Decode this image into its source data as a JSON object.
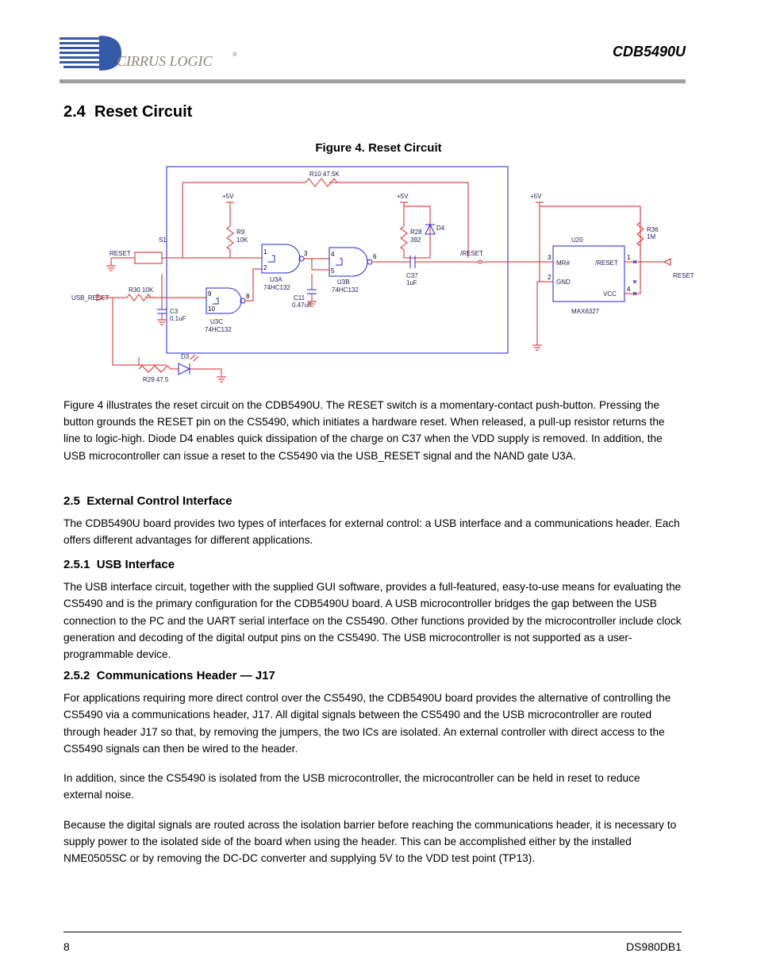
{
  "header": {
    "brand": "CIRRUS LOGIC",
    "doc_id": "CDB5490U"
  },
  "section": {
    "number": "2.4",
    "title": "Reset Circuit"
  },
  "figure": {
    "caption_label": "Figure 4.",
    "caption_text": "Reset Circuit",
    "labels": {
      "sw_reset": "RESET",
      "sw_ref": "S1",
      "vdd": "+5V",
      "r9": "R9",
      "r9_val": "10K",
      "r30": "R30",
      "r30_val": "10K",
      "r10": "R10",
      "r10_val": "47.5K",
      "r28": "R28",
      "r28_val": "392",
      "r29": "R29",
      "r29_val": "47.5",
      "c3": "C3",
      "c3_val": "0.1uF",
      "c11": "C11",
      "c11_val": "0.47uF",
      "d4": "D4",
      "c37": "C37",
      "c37_val": "1uF",
      "d3": "D3",
      "reset_net": "/RESET",
      "usb_reset_net": "USB_RESET",
      "reset_out": "RESET",
      "gate_u3a": "U3A",
      "gate_u3b": "U3B",
      "gate_u3c": "U3C",
      "gate_part": "74HC132",
      "pins": {
        "u3a_1": "1",
        "u3a_2": "2",
        "u3a_3": "3",
        "u3b_4": "4",
        "u3b_5": "5",
        "u3b_6": "6",
        "u3c_8": "8",
        "u3c_9": "9",
        "u3c_10": "10"
      },
      "ic_ref": "U20",
      "ic_part": "MAX6327",
      "ic_pin_reset": "/RESET",
      "ic_pin_mr": "MR#",
      "ic_pin_gnd": "GND",
      "ic_pin_vcc": "VCC",
      "ic_num1": "1",
      "ic_num2": "2",
      "ic_num3": "3",
      "ic_num4": "4",
      "r36": "R36",
      "r36_val": "1M"
    }
  },
  "body": {
    "s24_p1": "Figure 4 illustrates the reset circuit on the CDB5490U. The RESET switch is a momentary-contact push-button. Pressing the button grounds the RESET pin on the CS5490, which initiates a hardware reset. When released, a pull-up resistor returns the line to logic-high. Diode D4 enables quick dissipation of the charge on C37 when the VDD supply is removed. In addition, the USB microcontroller can issue a reset to the CS5490 via the USB_RESET signal and the NAND gate U3A.",
    "s25_num": "2.5",
    "s25_title": "External Control Interface",
    "s25_p1": "The CDB5490U board provides two types of interfaces for external control: a USB interface and a communications header. Each offers different advantages for different applications.",
    "s251_num": "2.5.1",
    "s251_title": "USB Interface",
    "s251_p1": "The USB interface circuit, together with the supplied GUI software, provides a full-featured, easy-to-use means for evaluating the CS5490 and is the primary configuration for the CDB5490U board. A USB microcontroller bridges the gap between the USB connection to the PC and the UART serial interface on the CS5490. Other functions provided by the microcontroller include clock generation and decoding of the digital output pins on the CS5490. The USB microcontroller is not supported as a user-programmable device.",
    "s252_num": "2.5.2",
    "s252_title": "Communications Header — J17",
    "s252_p1": "For applications requiring more direct control over the CS5490, the CDB5490U board provides the alternative of controlling the CS5490 via a communications header, J17. All digital signals between the CS5490 and the USB microcontroller are routed through header J17 so that, by removing the jumpers, the two ICs are isolated. An external controller with direct access to the CS5490 signals can then be wired to the header.",
    "s252_p2": "In addition, since the CS5490 is isolated from the USB microcontroller, the microcontroller can be held in reset to reduce external noise.",
    "s252_p3": "Because the digital signals are routed across the isolation barrier before reaching the communications header, it is necessary to supply power to the isolated side of the board when using the header. This can be accomplished either by the installed NME0505SC or by removing the DC-DC converter and supplying 5V to the VDD test point (TP13)."
  },
  "footer": {
    "page": "8",
    "doc_rev": "DS980DB1"
  }
}
